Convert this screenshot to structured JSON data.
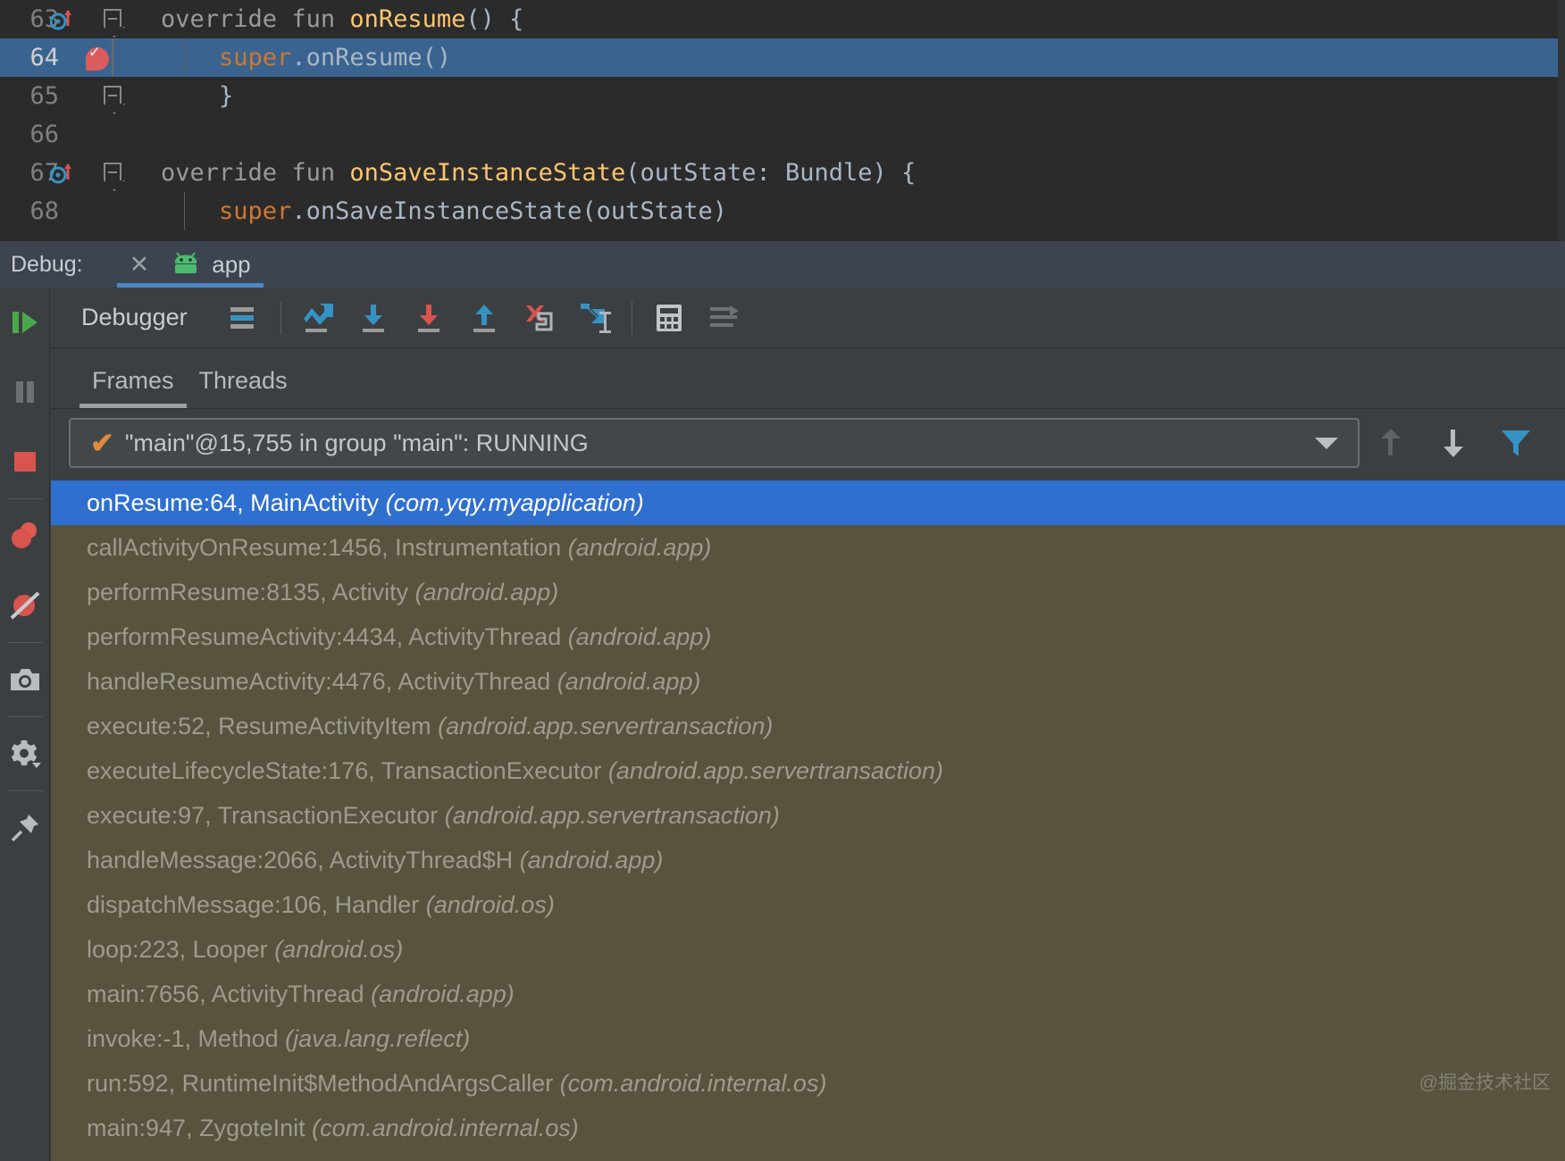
{
  "editor": {
    "lines": [
      {
        "num": "63",
        "has_breakpoint_run": true,
        "has_fold": true,
        "highlight": false,
        "tokens": [
          {
            "t": "override ",
            "c": "kw"
          },
          {
            "t": "fun ",
            "c": "kw"
          },
          {
            "t": "onResume",
            "c": "fn"
          },
          {
            "t": "() {",
            "c": "pn"
          }
        ]
      },
      {
        "num": "64",
        "has_breakpoint_hit": true,
        "highlight": true,
        "indent": true,
        "tokens": [
          {
            "t": "    ",
            "c": "pn"
          },
          {
            "t": "super",
            "c": "sup"
          },
          {
            "t": ".onResume()",
            "c": "id"
          }
        ]
      },
      {
        "num": "65",
        "has_fold_end": true,
        "highlight": false,
        "tokens": [
          {
            "t": "    }",
            "c": "pn"
          }
        ]
      },
      {
        "num": "66",
        "highlight": false,
        "tokens": [
          {
            "t": "",
            "c": "pn"
          }
        ]
      },
      {
        "num": "67",
        "has_breakpoint_run": true,
        "has_fold": true,
        "highlight": false,
        "tokens": [
          {
            "t": "override ",
            "c": "kw"
          },
          {
            "t": "fun ",
            "c": "kw"
          },
          {
            "t": "onSaveInstanceState",
            "c": "fn"
          },
          {
            "t": "(outState: Bundle) {",
            "c": "typ"
          }
        ]
      },
      {
        "num": "68",
        "highlight": false,
        "indent": true,
        "tokens": [
          {
            "t": "    ",
            "c": "pn"
          },
          {
            "t": "super",
            "c": "sup"
          },
          {
            "t": ".onSaveInstanceState(outState)",
            "c": "id"
          }
        ]
      }
    ]
  },
  "debug_header": {
    "label": "Debug:",
    "close_icon": "close-icon",
    "app_icon": "android-icon",
    "tab_name": "app"
  },
  "sidebar": {
    "items": [
      {
        "name": "resume-program",
        "icon": "resume-icon"
      },
      {
        "name": "pause-program",
        "icon": "pause-icon"
      },
      {
        "name": "stop-program",
        "icon": "stop-icon"
      },
      {
        "name": "view-breakpoints",
        "icon": "breakpoints-icon"
      },
      {
        "name": "mute-breakpoints",
        "icon": "mute-breakpoints-icon"
      },
      {
        "name": "screenshot",
        "icon": "camera-icon"
      },
      {
        "name": "settings",
        "icon": "gear-icon"
      },
      {
        "name": "pin-tab",
        "icon": "pin-icon"
      }
    ]
  },
  "debugger": {
    "title": "Debugger",
    "toolbar": [
      {
        "name": "show-execution-point",
        "icon": "execution-point-icon"
      },
      {
        "name": "step-over",
        "icon": "step-over-icon"
      },
      {
        "name": "step-into",
        "icon": "step-into-icon"
      },
      {
        "name": "force-step-into",
        "icon": "force-step-into-icon"
      },
      {
        "name": "step-out",
        "icon": "step-out-icon"
      },
      {
        "name": "drop-frame",
        "icon": "drop-frame-icon"
      },
      {
        "name": "run-to-cursor",
        "icon": "run-to-cursor-icon"
      },
      {
        "name": "evaluate-expression",
        "icon": "calculator-icon"
      },
      {
        "name": "layout-settings",
        "icon": "layout-icon"
      }
    ],
    "tabs": [
      {
        "label": "Frames",
        "active": true
      },
      {
        "label": "Threads",
        "active": false
      }
    ],
    "thread_selector": {
      "value": "\"main\"@15,755 in group \"main\": RUNNING",
      "status_icon": "check-icon"
    },
    "frame_nav": [
      {
        "name": "frame-up",
        "icon": "arrow-up-icon"
      },
      {
        "name": "frame-down",
        "icon": "arrow-down-icon"
      },
      {
        "name": "filter-frames",
        "icon": "filter-icon"
      }
    ],
    "frames": [
      {
        "method": "onResume:64, MainActivity",
        "pkg": "(com.yqy.myapplication)",
        "selected": true
      },
      {
        "method": "callActivityOnResume:1456, Instrumentation",
        "pkg": "(android.app)",
        "selected": false
      },
      {
        "method": "performResume:8135, Activity",
        "pkg": "(android.app)",
        "selected": false
      },
      {
        "method": "performResumeActivity:4434, ActivityThread",
        "pkg": "(android.app)",
        "selected": false
      },
      {
        "method": "handleResumeActivity:4476, ActivityThread",
        "pkg": "(android.app)",
        "selected": false
      },
      {
        "method": "execute:52, ResumeActivityItem",
        "pkg": "(android.app.servertransaction)",
        "selected": false
      },
      {
        "method": "executeLifecycleState:176, TransactionExecutor",
        "pkg": "(android.app.servertransaction)",
        "selected": false
      },
      {
        "method": "execute:97, TransactionExecutor",
        "pkg": "(android.app.servertransaction)",
        "selected": false
      },
      {
        "method": "handleMessage:2066, ActivityThread$H",
        "pkg": "(android.app)",
        "selected": false
      },
      {
        "method": "dispatchMessage:106, Handler",
        "pkg": "(android.os)",
        "selected": false
      },
      {
        "method": "loop:223, Looper",
        "pkg": "(android.os)",
        "selected": false
      },
      {
        "method": "main:7656, ActivityThread",
        "pkg": "(android.app)",
        "selected": false
      },
      {
        "method": "invoke:-1, Method",
        "pkg": "(java.lang.reflect)",
        "selected": false
      },
      {
        "method": "run:592, RuntimeInit$MethodAndArgsCaller",
        "pkg": "(com.android.internal.os)",
        "selected": false
      },
      {
        "method": "main:947, ZygoteInit",
        "pkg": "(com.android.internal.os)",
        "selected": false
      }
    ]
  },
  "watermark": "@掘金技术社区",
  "colors": {
    "editor_bg": "#2b2b2b",
    "highlight_line": "#3a648f",
    "frames_bg": "#57533f",
    "frame_selected": "#2f6fd0",
    "debug_header_bg": "#3c4450",
    "panel_bg": "#3c3f41",
    "accent_blue": "#4a88c7",
    "keyword": "#cc7832",
    "function": "#ffc66d"
  }
}
